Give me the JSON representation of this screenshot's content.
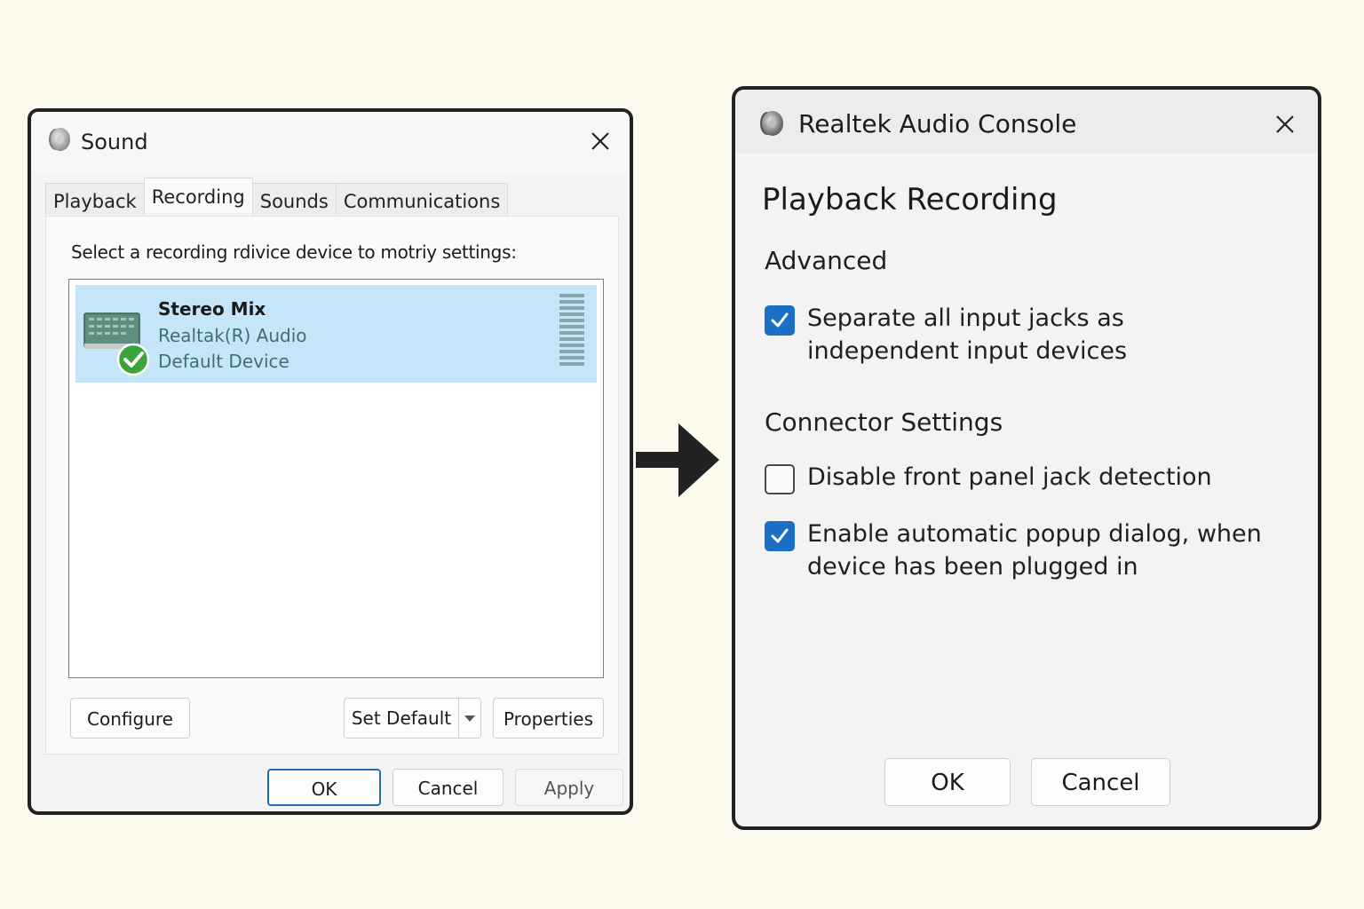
{
  "sound_window": {
    "title": "Sound",
    "tabs": [
      {
        "label": "Playback",
        "active": false
      },
      {
        "label": "Recording",
        "active": true
      },
      {
        "label": "Sounds",
        "active": false
      },
      {
        "label": "Communications",
        "active": false
      }
    ],
    "instruction": "Select a recording rdivice device to motriy settings:",
    "devices": [
      {
        "name": "Stereo Mix",
        "driver": "Realtak(R) Audio",
        "status": "Default Device",
        "selected": true,
        "is_default": true
      }
    ],
    "buttons": {
      "configure": "Configure",
      "set_default": "Set Default",
      "properties": "Properties",
      "ok": "OK",
      "cancel": "Cancel",
      "apply": "Apply"
    },
    "icons": {
      "app": "speaker-icon",
      "close": "close-icon",
      "device": "stereo-mix-icon",
      "default_badge": "green-check-icon",
      "dropdown": "dropdown-arrow-icon"
    }
  },
  "realtek_window": {
    "title": "Realtek Audio Console",
    "heading": "Playback Recording",
    "advanced": {
      "label": "Advanced",
      "options": [
        {
          "label": "Separate all input jacks as independent input devices",
          "checked": true
        }
      ]
    },
    "connector_settings": {
      "label": "Connector Settings",
      "options": [
        {
          "label": "Disable front panel jack detection",
          "checked": false
        },
        {
          "label": "Enable automatic popup dialog, when device has been plugged in",
          "checked": true
        }
      ]
    },
    "buttons": {
      "ok": "OK",
      "cancel": "Cancel"
    },
    "icons": {
      "app": "speaker-icon",
      "close": "close-icon"
    }
  },
  "colors": {
    "background": "#fdfbee",
    "selection": "#c5e6f8",
    "accent": "#1b6fc4",
    "default_badge": "#3aa33a",
    "driver_text": "#3f6f72"
  }
}
